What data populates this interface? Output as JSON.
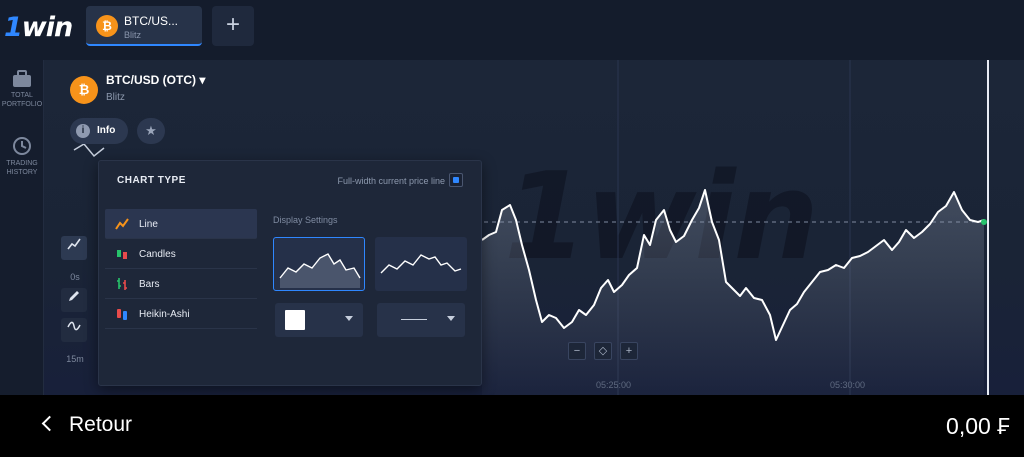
{
  "app": {
    "logo_prefix": "1",
    "logo_suffix": "win"
  },
  "tabs": [
    {
      "title": "BTC/US...",
      "subtitle": "Blitz",
      "icon": "bitcoin-icon",
      "active": true
    }
  ],
  "add_tab_label": "+",
  "sidebar": {
    "items": [
      {
        "label": "TOTAL PORTFOLIO",
        "icon": "briefcase-icon"
      },
      {
        "label": "TRADING HISTORY",
        "icon": "history-icon"
      }
    ]
  },
  "asset": {
    "title": "BTC/USD (OTC) ▾",
    "subtitle": "Blitz",
    "coin_symbol": "₿",
    "coin_badge": "OTC",
    "info_label": "Info",
    "star_icon": "star-icon"
  },
  "tools": {
    "items": [
      {
        "icon": "line-chart-icon",
        "active": true
      },
      {
        "label": "0s"
      },
      {
        "icon": "pencil-icon"
      },
      {
        "icon": "wave-indicator-icon"
      },
      {
        "label": "15m"
      }
    ]
  },
  "chart_panel": {
    "title": "CHART TYPE",
    "full_width_label": "Full-width current price line",
    "full_width_checked": true,
    "types": [
      {
        "label": "Line",
        "icon": "line-icon",
        "active": true
      },
      {
        "label": "Candles",
        "icon": "candles-icon",
        "active": false
      },
      {
        "label": "Bars",
        "icon": "bars-icon",
        "active": false
      },
      {
        "label": "Heikin-Ashi",
        "icon": "heikin-ashi-icon",
        "active": false
      }
    ],
    "display_settings_label": "Display Settings",
    "line_color": "#ffffff",
    "line_style": "solid"
  },
  "zoom": {
    "minus": "−",
    "center": "◇",
    "plus": "+"
  },
  "time_labels": [
    "05:25:00",
    "05:30:00"
  ],
  "bottom": {
    "back_label": "Retour",
    "balance": "0,00 ₣"
  },
  "colors": {
    "accent": "#2f87ff",
    "bitcoin": "#f7931a",
    "background": "#0f1525"
  }
}
